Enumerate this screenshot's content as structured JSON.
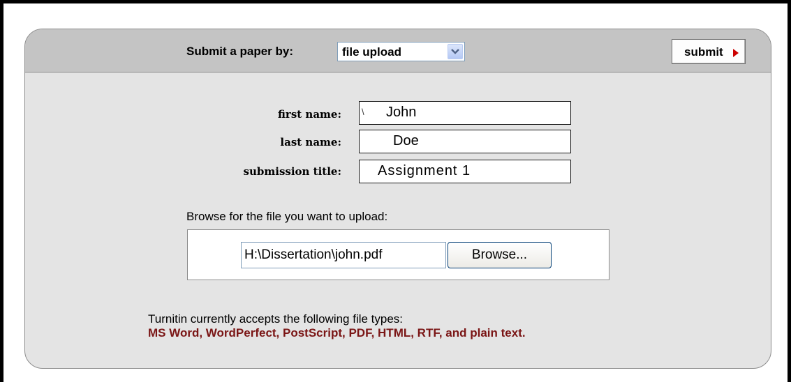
{
  "header": {
    "submit_by_label": "Submit a paper by:",
    "method_select": {
      "selected": "file upload"
    },
    "submit_label": "submit"
  },
  "form": {
    "fields": [
      {
        "label": "first name:",
        "value": "John"
      },
      {
        "label": "last name:",
        "value": "Doe"
      },
      {
        "label": "submission title:",
        "value": "Assignment 1"
      }
    ],
    "browse_prompt": "Browse for the file you want to upload:",
    "file_path": "H:\\Dissertation\\john.pdf",
    "browse_label": "Browse..."
  },
  "footer": {
    "accepts_text": "Turnitin currently accepts the following file types:",
    "file_types": "MS Word, WordPerfect, PostScript, PDF, HTML, RTF, and plain text."
  },
  "colors": {
    "file_types_text": "#7a1515",
    "submit_arrow": "#cc0000",
    "header_band": "#c4c4c4",
    "panel_body": "#e4e4e4"
  },
  "icons": {
    "select_arrow": "chevron-down-icon",
    "submit_arrow": "triangle-right-icon"
  }
}
